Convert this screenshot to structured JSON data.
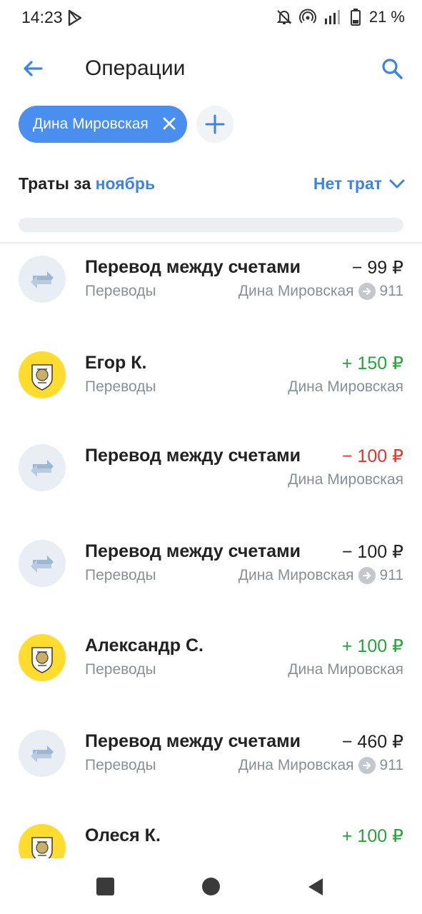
{
  "status_bar": {
    "time": "14:23",
    "battery": "21 %",
    "icons": [
      "play-store-icon",
      "bell-off-icon",
      "hotspot-icon",
      "signal-icon",
      "battery-icon"
    ]
  },
  "header": {
    "title": "Операции",
    "back_icon": "arrow-left-icon",
    "search_icon": "search-icon"
  },
  "filter": {
    "chip_label": "Дина Мировская",
    "add_icon": "plus-icon"
  },
  "summary": {
    "prefix": "Траты за",
    "month": "ноябрь",
    "status": "Нет трат"
  },
  "colors": {
    "accent": "#3d83e6",
    "income": "#26a33a",
    "expense_highlight": "#e2362b",
    "bank_avatar": "#ffdc2e"
  },
  "transactions": [
    {
      "title": "Перевод между счетами",
      "category": "Переводы",
      "amount": "− 99 ₽",
      "account": "Дина Мировская",
      "account_suffix": "911",
      "avatar": "transfer-icon"
    },
    {
      "title": "Егор К.",
      "category": "Переводы",
      "amount": "+ 150 ₽",
      "account": "Дина Мировская",
      "account_suffix": "",
      "avatar": "bank-logo-icon"
    },
    {
      "title": "Перевод между счетами",
      "category": "",
      "amount": "− 100 ₽",
      "account": "Дина Мировская",
      "account_suffix": "",
      "avatar": "transfer-icon"
    },
    {
      "title": "Перевод между счетами",
      "category": "Переводы",
      "amount": "− 100 ₽",
      "account": "Дина Мировская",
      "account_suffix": "911",
      "avatar": "transfer-icon"
    },
    {
      "title": "Александр С.",
      "category": "Переводы",
      "amount": "+ 100 ₽",
      "account": "Дина Мировская",
      "account_suffix": "",
      "avatar": "bank-logo-icon"
    },
    {
      "title": "Перевод между счетами",
      "category": "Переводы",
      "amount": "− 460 ₽",
      "account": "Дина Мировская",
      "account_suffix": "911",
      "avatar": "transfer-icon"
    },
    {
      "title": "Олеся К.",
      "category": "",
      "amount": "+ 100 ₽",
      "account": "",
      "account_suffix": "",
      "avatar": "bank-logo-icon"
    }
  ],
  "nav": {
    "recents_icon": "square-icon",
    "home_icon": "circle-icon",
    "back_icon": "triangle-back-icon"
  }
}
